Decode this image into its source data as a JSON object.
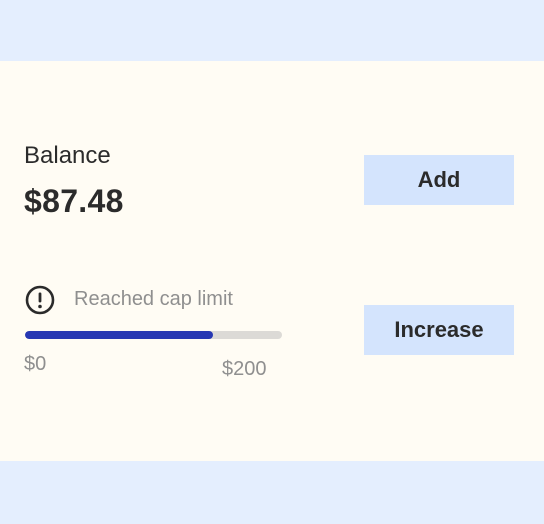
{
  "balance": {
    "label": "Balance",
    "value": "$87.48"
  },
  "actions": {
    "add_label": "Add",
    "increase_label": "Increase"
  },
  "cap": {
    "icon": "alert-circle-icon",
    "message": "Reached cap limit",
    "progress_fraction": 0.73,
    "min_label": "$0",
    "max_label": "$200"
  },
  "colors": {
    "page_background": "#e4eefe",
    "card_background": "#fffcf4",
    "button_background": "#d4e4fd",
    "progress_fill": "#2738b3",
    "progress_track": "#dcdad6",
    "text_primary": "#2b2b2b",
    "text_muted": "#8f8f8f"
  }
}
